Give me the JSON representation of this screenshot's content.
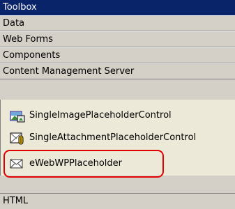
{
  "window": {
    "title": "Toolbox"
  },
  "categories": [
    {
      "label": "Data"
    },
    {
      "label": "Web Forms"
    },
    {
      "label": "Components"
    },
    {
      "label": "Content Management Server"
    }
  ],
  "items": [
    {
      "label": "SingleImagePlaceholderControl",
      "icon": "image-placeholder-icon"
    },
    {
      "label": "SingleAttachmentPlaceholderControl",
      "icon": "attachment-placeholder-icon"
    },
    {
      "label": "eWebWPPlaceholder",
      "icon": "envelope-icon"
    }
  ],
  "bottom_category": {
    "label": "HTML"
  },
  "colors": {
    "title_bar": "#0a246a",
    "highlight_outline": "#e00000",
    "tab_background": "#d4d0c8"
  }
}
